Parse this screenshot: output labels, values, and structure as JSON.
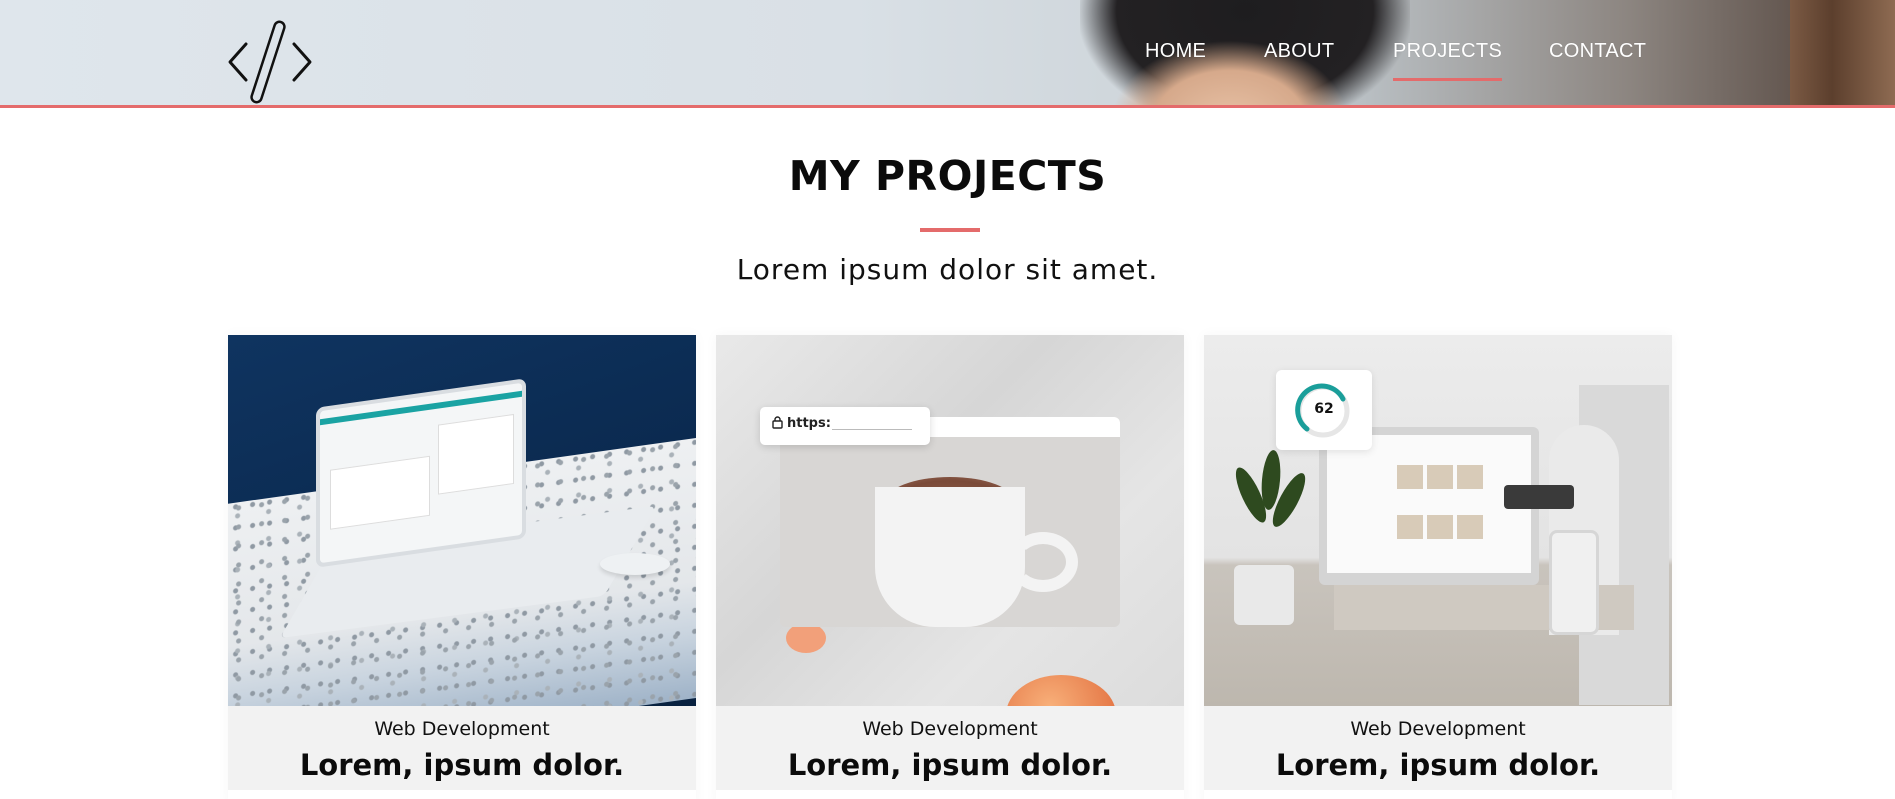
{
  "header": {
    "logo_name": "code-brackets-logo",
    "nav": [
      {
        "label": "HOME",
        "active": false
      },
      {
        "label": "ABOUT",
        "active": false
      },
      {
        "label": "PROJECTS",
        "active": true
      },
      {
        "label": "CONTACT",
        "active": false
      }
    ],
    "accent_color": "#e46b6b"
  },
  "section": {
    "title": "MY PROJECTS",
    "subtitle": "Lorem ipsum dolor sit amet."
  },
  "projects": [
    {
      "category": "Web Development",
      "title": "Lorem, ipsum dolor."
    },
    {
      "category": "Web Development",
      "title": "Lorem, ipsum dolor.",
      "url_text": "https:"
    },
    {
      "category": "Web Development",
      "title": "Lorem, ipsum dolor.",
      "score": "62"
    }
  ]
}
